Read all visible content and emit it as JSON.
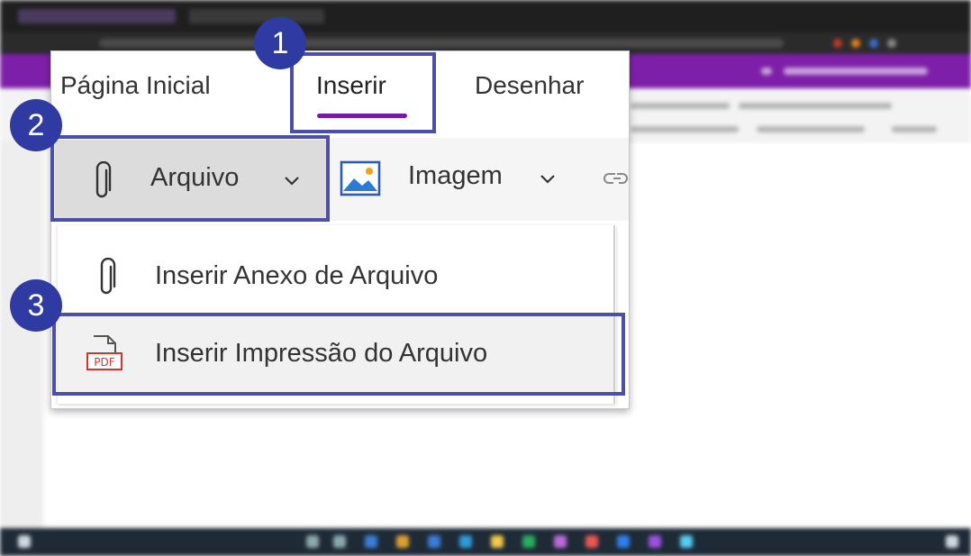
{
  "tabs": [
    {
      "label": "Página Inicial"
    },
    {
      "label": "Inserir"
    },
    {
      "label": "Desenhar"
    }
  ],
  "active_tab": "Inserir",
  "toolbar": {
    "file_label": "Arquivo",
    "image_label": "Imagem"
  },
  "file_menu": {
    "items": [
      {
        "label": "Inserir Anexo de Arquivo",
        "icon": "paperclip-icon"
      },
      {
        "label": "Inserir Impressão do Arquivo",
        "icon": "pdf-icon",
        "pdf_text": "PDF"
      }
    ]
  },
  "steps": [
    "1",
    "2",
    "3"
  ],
  "colors": {
    "accent": "#7719aa",
    "highlight_box": "#4b4fa8",
    "step_circle": "#2f3ba3",
    "pdf_red": "#d9302c"
  }
}
